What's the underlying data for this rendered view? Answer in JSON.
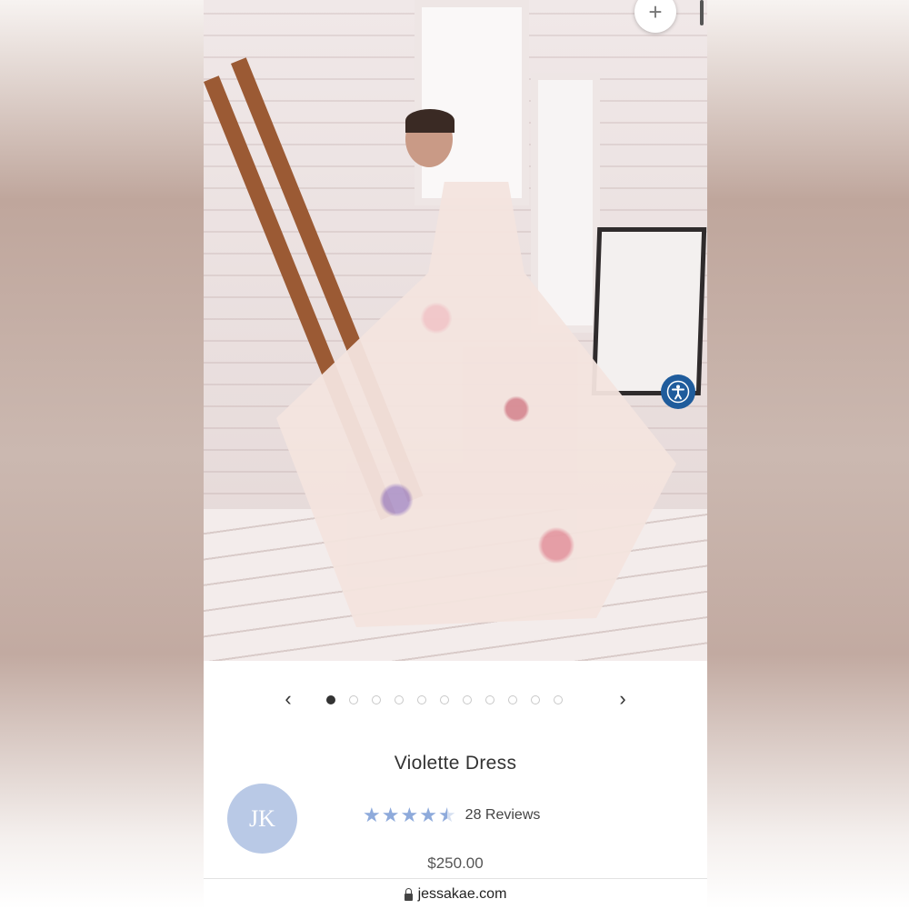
{
  "product": {
    "title": "Violette Dress",
    "rating": 4.5,
    "stars_max": 5,
    "reviews_label": "28 Reviews",
    "price": "$250.00"
  },
  "brand": {
    "logo_text": "JK"
  },
  "carousel": {
    "prev_icon": "‹",
    "next_icon": "›",
    "dot_count": 11,
    "active_index": 0
  },
  "buttons": {
    "plus_icon": "+"
  },
  "browser": {
    "url": "jessakae.com"
  },
  "colors": {
    "accent": "#8eaadb",
    "logo_bg": "#b9c9e6",
    "accessibility_bg": "#1f5c9c"
  }
}
